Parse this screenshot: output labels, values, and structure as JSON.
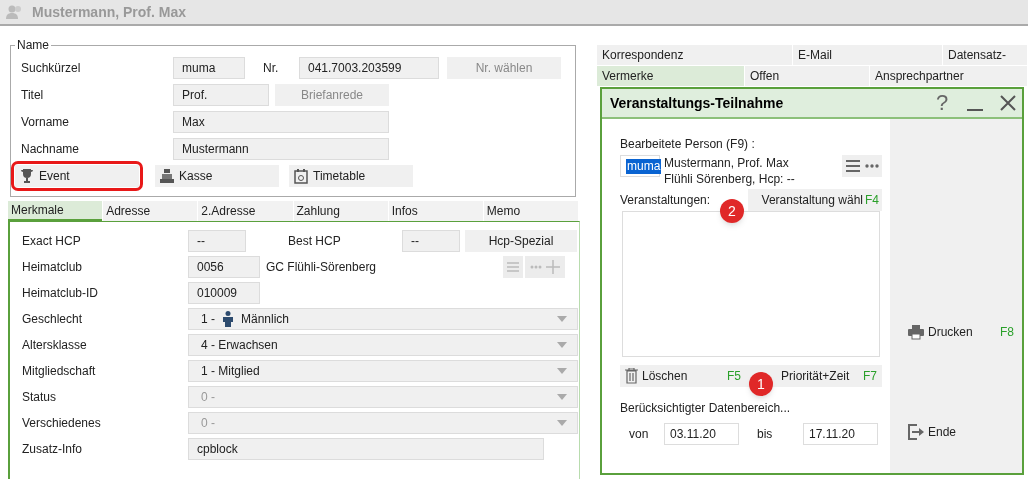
{
  "window": {
    "title": "Mustermann, Prof. Max"
  },
  "name_group": {
    "legend": "Name",
    "rows": [
      {
        "label": "Suchkürzel",
        "value": "muma",
        "extra_label": "Nr.",
        "extra_value": "041.7003.203599",
        "button": "Nr. wählen"
      },
      {
        "label": "Titel",
        "value": "Prof.",
        "button": "Briefanrede"
      },
      {
        "label": "Vorname",
        "value": "Max"
      },
      {
        "label": "Nachname",
        "value": "Mustermann"
      }
    ],
    "actions": [
      {
        "label": "Event",
        "highlighted": true
      },
      {
        "label": "Kasse",
        "highlighted": false
      },
      {
        "label": "Timetable",
        "highlighted": false
      }
    ]
  },
  "tabs": [
    {
      "label": "Merkmale",
      "selected": true
    },
    {
      "label": "Adresse",
      "selected": false
    },
    {
      "label": "2.Adresse",
      "selected": false
    },
    {
      "label": "Zahlung",
      "selected": false
    },
    {
      "label": "Infos",
      "selected": false
    },
    {
      "label": "Memo",
      "selected": false
    }
  ],
  "merkmale": [
    {
      "kind": "hcp",
      "label": "Exact HCP",
      "value": "--",
      "label2": "Best HCP",
      "value2": "--",
      "button": "Hcp-Spezial"
    },
    {
      "kind": "club",
      "label": "Heimatclub",
      "value": "0056",
      "name": "GC Flühli-Sörenberg"
    },
    {
      "kind": "text",
      "label": "Heimatclub-ID",
      "value": "010009"
    },
    {
      "kind": "select",
      "label": "Geschlecht",
      "code": "1 -",
      "value": "Männlich",
      "person_icon": true,
      "disabled": false
    },
    {
      "kind": "select",
      "label": "Altersklasse",
      "value": "4 - Erwachsen",
      "disabled": false
    },
    {
      "kind": "select",
      "label": "Mitgliedschaft",
      "value": "1 - Mitglied",
      "disabled": false
    },
    {
      "kind": "select",
      "label": "Status",
      "value": "0 -",
      "disabled": true
    },
    {
      "kind": "select",
      "label": "Verschiedenes",
      "value": "0 -",
      "disabled": true
    },
    {
      "kind": "memo",
      "label": "Zusatz-Info",
      "value": "cpblock"
    }
  ],
  "right_tabs": [
    [
      {
        "label": "Korrespondenz",
        "selected": false
      },
      {
        "label": "E-Mail",
        "selected": false
      },
      {
        "label": "Datensatz-",
        "selected": false
      }
    ],
    [
      {
        "label": "Vermerke",
        "selected": true
      },
      {
        "label": "Offen",
        "selected": false
      },
      {
        "label": "Ansprechpartner",
        "selected": false
      }
    ]
  ],
  "dialog": {
    "title": "Veranstaltungs-Teilnahme",
    "help": "?",
    "person_label": "Bearbeitete Person (F9) :",
    "person_code": "muma",
    "person_name": "Mustermann, Prof. Max",
    "person_detail": "Flühli Sörenberg, Hcp: --",
    "events_label": "Veranstaltungen:",
    "choose_button": {
      "label": "Veranstaltung wähl",
      "key": "F4"
    },
    "bottom_buttons": [
      {
        "label": "Löschen",
        "key": "F5"
      },
      {
        "label": "Priorität+Zeit",
        "key": "F7"
      }
    ],
    "range_label": "Berücksichtigter Datenbereich...",
    "from_label": "von",
    "from": "03.11.20",
    "to_label": "bis",
    "to": "17.11.20",
    "side_buttons": [
      {
        "label": "Drucken",
        "key": "F8"
      },
      {
        "label": "Ende"
      }
    ]
  },
  "callouts": [
    {
      "number": "2"
    },
    {
      "number": "1"
    }
  ]
}
